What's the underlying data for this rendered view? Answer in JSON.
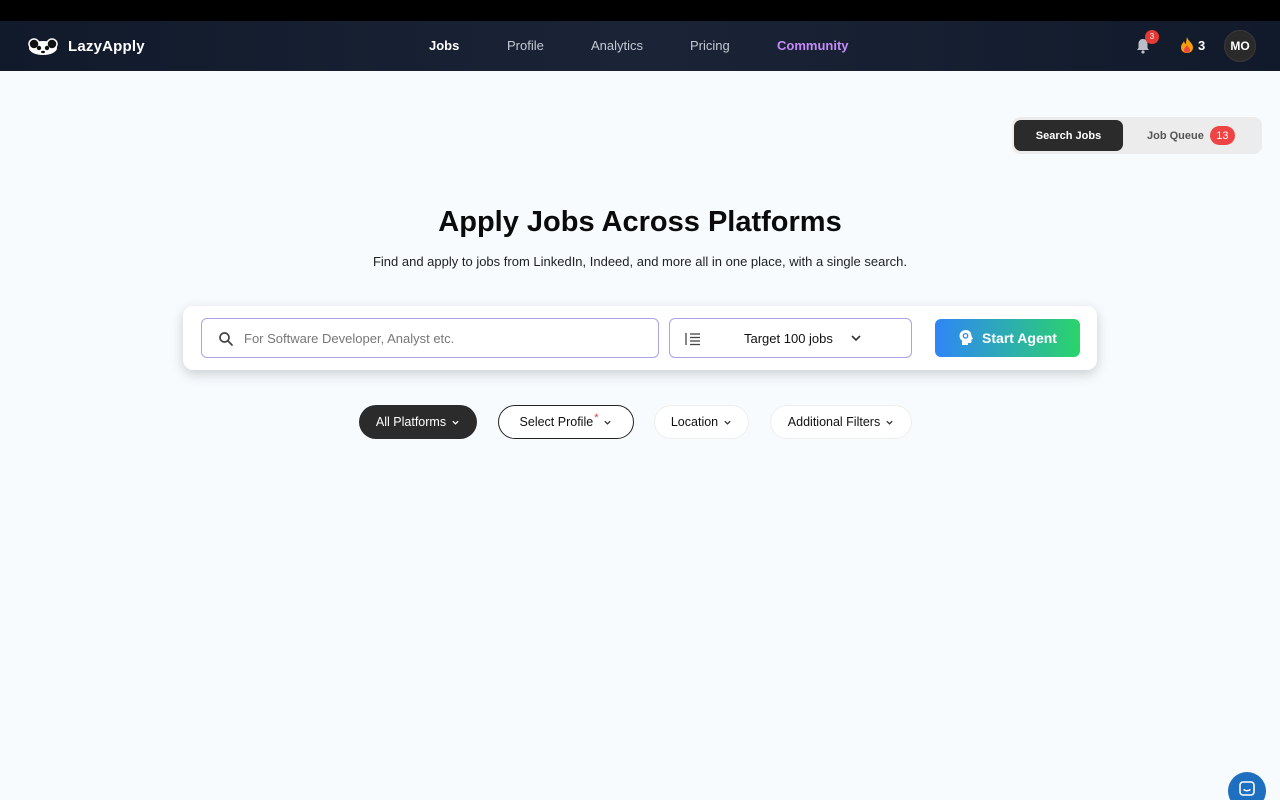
{
  "nav": {
    "brand": "LazyApply",
    "links": [
      "Jobs",
      "Profile",
      "Analytics",
      "Pricing",
      "Community"
    ],
    "notification_count": "3",
    "streak_count": "3",
    "avatar_initials": "MO"
  },
  "toggle": {
    "search_label": "Search Jobs",
    "queue_label": "Job Queue",
    "queue_count": "13"
  },
  "hero": {
    "title": "Apply Jobs Across Platforms",
    "subtitle": "Find and apply to jobs from LinkedIn, Indeed, and more all in one place, with a single search."
  },
  "search": {
    "placeholder": "For Software Developer, Analyst etc.",
    "value": "",
    "target_label": "Target 100 jobs",
    "start_label": "Start Agent"
  },
  "filters": {
    "platforms": "All Platforms",
    "profile": "Select Profile",
    "profile_required_mark": "*",
    "location": "Location",
    "additional": "Additional Filters"
  },
  "colors": {
    "accent_purple": "#c58af9",
    "badge_red": "#ef4444",
    "start_gradient_from": "#2f86f6",
    "start_gradient_to": "#2bd46a"
  },
  "icons": [
    "panda-logo-icon",
    "bell-icon",
    "flame-icon",
    "search-icon",
    "list-icon",
    "chevron-down-icon",
    "brain-icon",
    "chat-icon"
  ]
}
